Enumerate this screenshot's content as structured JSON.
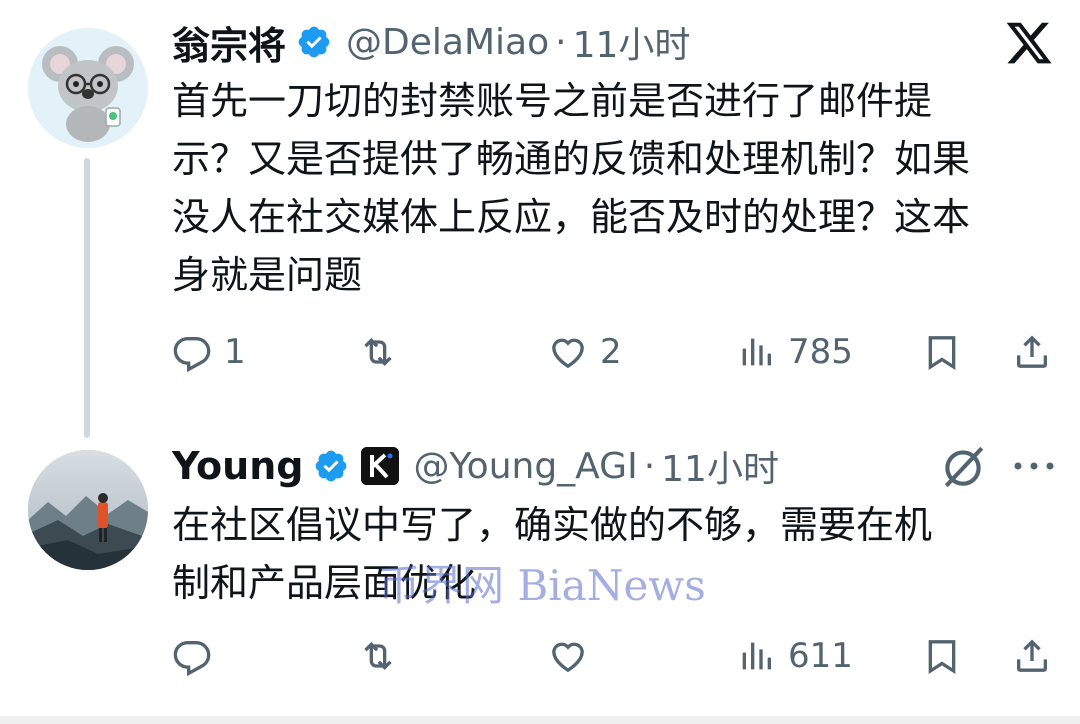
{
  "tweets": [
    {
      "name": "翁宗将",
      "handle": "@DelaMiao",
      "separator": "·",
      "time": "11小时",
      "text_lines": [
        "首先一刀切的封禁账号之前是否进行了邮件提",
        "示？又是否提供了畅通的反馈和处理机制？如果",
        "没人在社交媒体上反应，能否及时的处理？这本",
        "身就是问题"
      ],
      "replies": "1",
      "reposts": "",
      "likes": "2",
      "views": "785"
    },
    {
      "name": "Young",
      "handle": "@Young_AGI",
      "separator": "·",
      "time": "11小时",
      "text_lines": [
        "在社区倡议中写了，确实做的不够，需要在机",
        "制和产品层面优化"
      ],
      "replies": "",
      "reposts": "",
      "likes": "",
      "views": "611"
    }
  ],
  "watermark": "币界网 BiaNews",
  "icons": {
    "reply": "reply-icon",
    "repost": "repost-icon",
    "like": "like-icon",
    "views": "views-icon",
    "bookmark": "bookmark-icon",
    "share": "share-icon",
    "verified": "verified-badge-icon",
    "x_logo": "x-logo-icon",
    "grok": "grok-icon",
    "more": "more-icon"
  },
  "colors": {
    "verified_blue": "#1d9bf0",
    "secondary_text": "#536471",
    "primary_text": "#0f1419",
    "thread_line": "#cfd9de"
  }
}
